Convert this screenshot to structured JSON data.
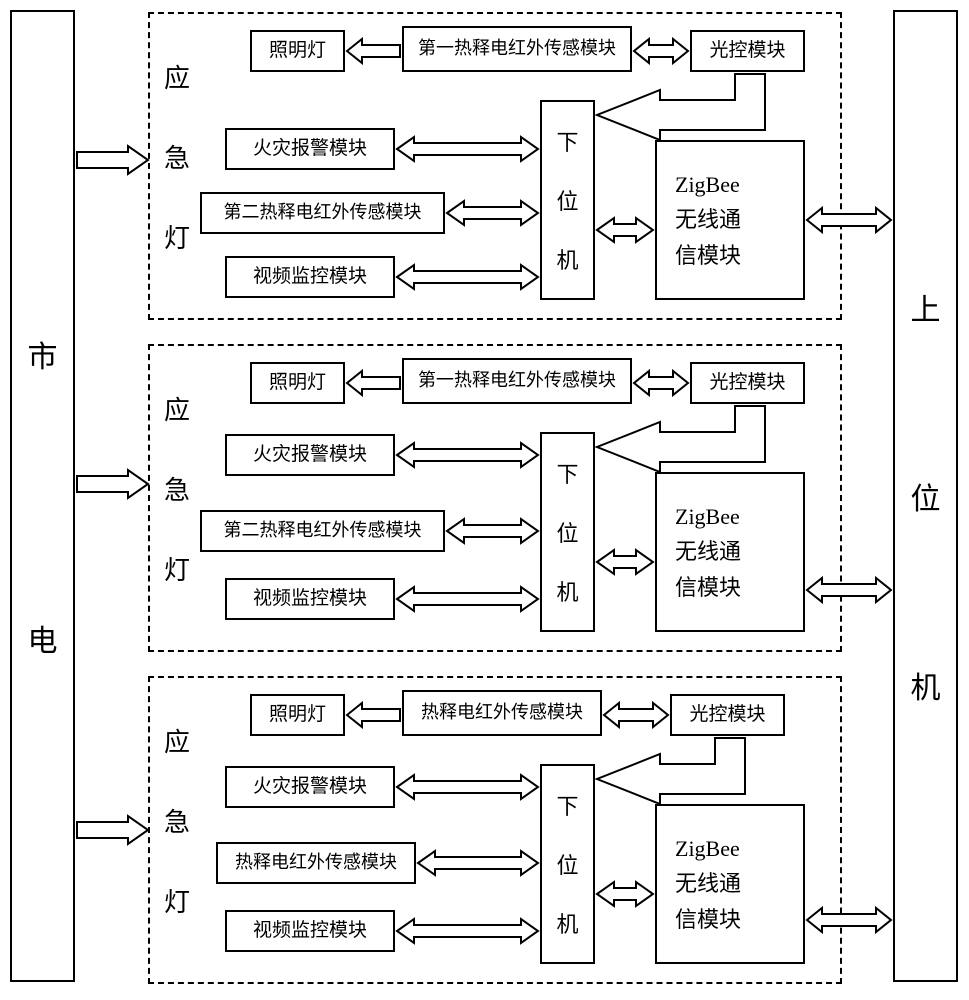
{
  "left_panel": "市电",
  "right_panel": "上位机",
  "group_label": "应急灯",
  "modules": {
    "lighting": "照明灯",
    "pyro_first": "第一热释电红外传感模块",
    "pyro_second": "第二热释电红外传感模块",
    "pyro_generic": "热释电红外传感模块",
    "light_control": "光控模块",
    "fire_alarm": "火灾报警模块",
    "video_monitor": "视频监控模块",
    "lower_machine": "下位机",
    "zigbee_line1": "ZigBee",
    "zigbee_line2": "无线通",
    "zigbee_line3": "信模块"
  }
}
